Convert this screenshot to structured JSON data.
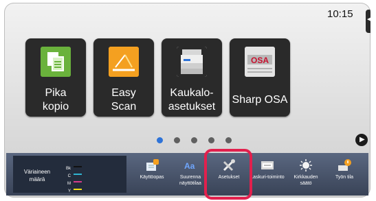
{
  "status": {
    "clock": "10:15",
    "edge_tab_icon": "◂"
  },
  "tiles": [
    {
      "label_line1": "Pika",
      "label_line2": "kopio",
      "icon": "copy-icon"
    },
    {
      "label_line1": "Easy",
      "label_line2": "Scan",
      "icon": "scanner-icon"
    },
    {
      "label_line1": "Kaukalo-",
      "label_line2": "asetukset",
      "icon": "printer-tray-icon"
    },
    {
      "label_line1": "Sharp OSA",
      "label_line2": "",
      "icon": "sharp-osa-icon",
      "badge": "OSA"
    }
  ],
  "pagination": {
    "pages": 5,
    "active_index": 0,
    "next_icon": "▶"
  },
  "toner": {
    "label": "Väriaineen määrä",
    "rows": [
      {
        "code": "Bk",
        "color": "#111111"
      },
      {
        "code": "C",
        "color": "#2fb4d2"
      },
      {
        "code": "M",
        "color": "#d63b8a"
      },
      {
        "code": "Y",
        "color": "#f2df1a"
      }
    ]
  },
  "functions": [
    {
      "label": "Käyttöopas",
      "icon": "guide-book-icon"
    },
    {
      "label": "Suurenna näyttötilaa",
      "icon": "zoom-display-icon"
    },
    {
      "label": "Asetukset",
      "icon": "settings-tools-icon"
    },
    {
      "label": "Laskuri-toiminto",
      "icon": "counter-icon"
    },
    {
      "label": "Kirkkauden säätö",
      "icon": "brightness-icon"
    },
    {
      "label": "Työn tila",
      "icon": "job-status-icon"
    }
  ],
  "colors": {
    "accent": "#2e73d8",
    "highlight": "#e2204d"
  }
}
